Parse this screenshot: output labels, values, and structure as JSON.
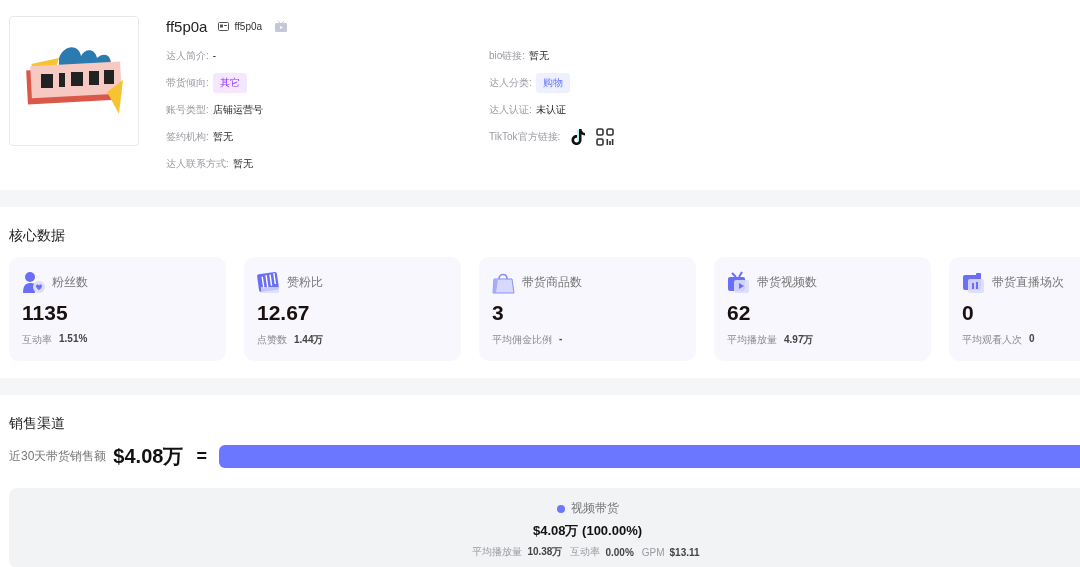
{
  "profile": {
    "name": "ff5p0a",
    "handle": "ff5p0a",
    "left_fields": [
      {
        "label": "达人简介:",
        "value": "-",
        "kind": "text"
      },
      {
        "label": "带货倾向:",
        "value": "其它",
        "kind": "tag",
        "color": "#f3e8ff"
      },
      {
        "label": "账号类型:",
        "value": "店铺运营号",
        "kind": "text"
      },
      {
        "label": "签约机构:",
        "value": "暂无",
        "kind": "text"
      },
      {
        "label": "达人联系方式:",
        "value": "暂无",
        "kind": "text"
      }
    ],
    "right_fields": [
      {
        "label": "bio链接:",
        "value": "暂无",
        "kind": "text"
      },
      {
        "label": "达人分类:",
        "value": "购物",
        "kind": "tag",
        "color": "#eef0ff"
      },
      {
        "label": "达人认证:",
        "value": "未认证",
        "kind": "text"
      },
      {
        "label": "TikTok官方链接:",
        "kind": "icons"
      }
    ]
  },
  "core_data": {
    "title": "核心数据",
    "cards": [
      {
        "kind": "fans",
        "label": "粉丝数",
        "value": "1135",
        "sub_label": "互动率",
        "sub_value": "1.51%"
      },
      {
        "kind": "ratio",
        "label": "赞粉比",
        "value": "12.67",
        "sub_label": "点赞数",
        "sub_value": "1.44万"
      },
      {
        "kind": "bag",
        "label": "带货商品数",
        "value": "3",
        "sub_label": "平均佣金比例",
        "sub_value": "-"
      },
      {
        "kind": "video",
        "label": "带货视频数",
        "value": "62",
        "sub_label": "平均播放量",
        "sub_value": "4.97万"
      },
      {
        "kind": "live",
        "label": "带货直播场次",
        "value": "0",
        "sub_label": "平均观看人次",
        "sub_value": "0"
      }
    ]
  },
  "sales": {
    "title": "销售渠道",
    "total_label": "近30天带货销售额",
    "total": "$4.08万",
    "equals": "=",
    "channels": [
      {
        "name": "视频带货",
        "color": "#6b77ff",
        "level": 1,
        "amount": "$4.08万 (100.00%)",
        "stats": [
          {
            "label": "平均播放量",
            "value": "10.38万"
          },
          {
            "label": "互动率",
            "value": "0.00%"
          },
          {
            "label": "GPM",
            "value": "$13.11"
          }
        ]
      }
    ]
  }
}
